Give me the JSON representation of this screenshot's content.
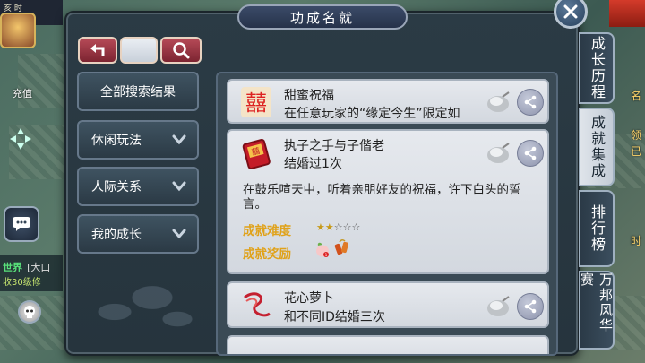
{
  "hud": {
    "time_text": "亥 时",
    "recharge_label": "充值",
    "chat_channel": "世界",
    "chat_tag": "[大口",
    "chat_line": "收30级修"
  },
  "dialog": {
    "title": "功成名就"
  },
  "toolbar": {
    "search_value": "",
    "back_icon": "back-arrow-icon",
    "search_icon": "magnifier-icon"
  },
  "categories": [
    {
      "label": "全部搜索结果",
      "expandable": false
    },
    {
      "label": "休闲玩法",
      "expandable": true
    },
    {
      "label": "人际关系",
      "expandable": true
    },
    {
      "label": "我的成长",
      "expandable": true
    }
  ],
  "achievements": [
    {
      "name": "甜蜜祝福",
      "desc": "在任意玩家的“缘定今生”限定如",
      "icon": "double-happiness-icon"
    },
    {
      "name": "执子之手与子偕老",
      "desc": "结婚过1次",
      "icon": "red-certificate-icon",
      "detail": "在鼓乐喧天中，听着亲朋好友的祝福，许下白头的誓言。",
      "difficulty_label": "成就难度",
      "difficulty_stars": 2,
      "difficulty_max": 5,
      "reward_label": "成就奖励",
      "reward_icons": [
        "peach-icon",
        "firecracker-icon"
      ]
    },
    {
      "name": "花心萝卜",
      "desc": "和不同ID结婚三次",
      "icon": "red-ribbon-icon"
    }
  ],
  "side_tabs": [
    {
      "label": "成长历程",
      "active": false
    },
    {
      "label": "成就集成",
      "active": true
    },
    {
      "label": "排行榜",
      "active": false
    },
    {
      "label": "万邦风华赛",
      "active": false
    }
  ],
  "right_edge_texts": [
    "名",
    "领",
    "已",
    "时"
  ],
  "colors": {
    "accent_red": "#9a3040",
    "highlight_gold": "#e0a21a",
    "panel_dark": "#2b3b45"
  }
}
